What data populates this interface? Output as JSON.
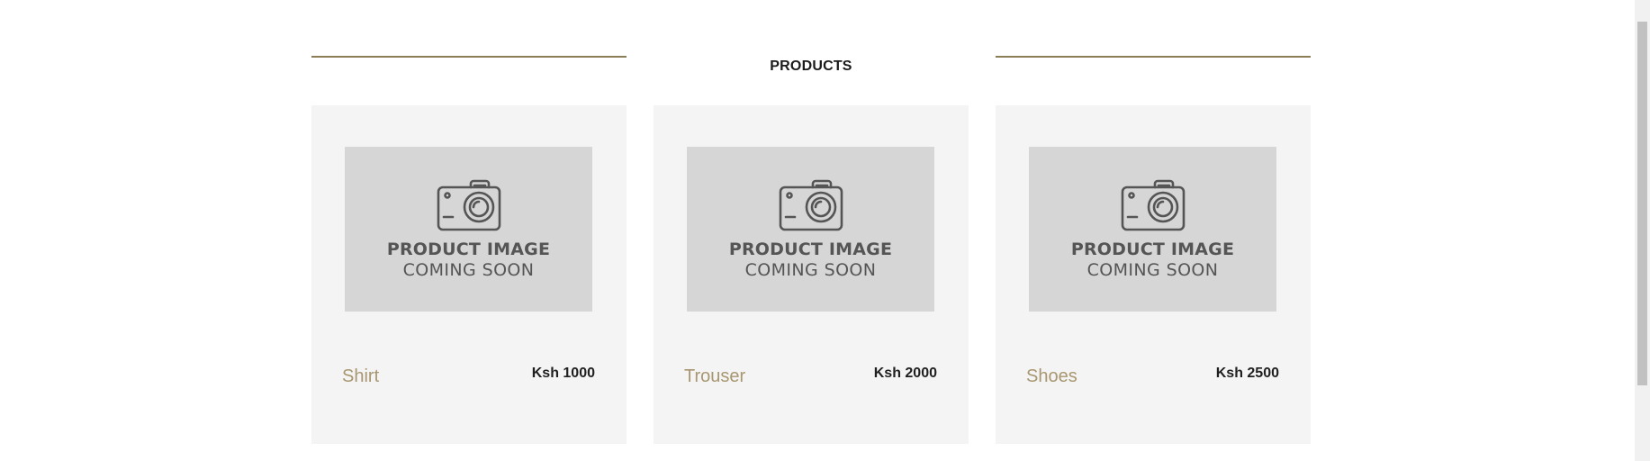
{
  "section": {
    "title": "PRODUCTS"
  },
  "products": [
    {
      "name": "Shirt",
      "price": "Ksh 1000",
      "placeholder_line1": "PRODUCT IMAGE",
      "placeholder_line2": "COMING SOON",
      "placeholder_icon": "camera-icon"
    },
    {
      "name": "Trouser",
      "price": "Ksh 2000",
      "placeholder_line1": "PRODUCT IMAGE",
      "placeholder_line2": "COMING SOON",
      "placeholder_icon": "camera-icon"
    },
    {
      "name": "Shoes",
      "price": "Ksh 2500",
      "placeholder_line1": "PRODUCT IMAGE",
      "placeholder_line2": "COMING SOON",
      "placeholder_icon": "camera-icon"
    }
  ],
  "colors": {
    "accent_rule": "#8b7d55",
    "product_name": "#a89770",
    "card_background": "#f4f4f5",
    "placeholder_background": "#d6d6d6",
    "placeholder_text": "#555555"
  }
}
